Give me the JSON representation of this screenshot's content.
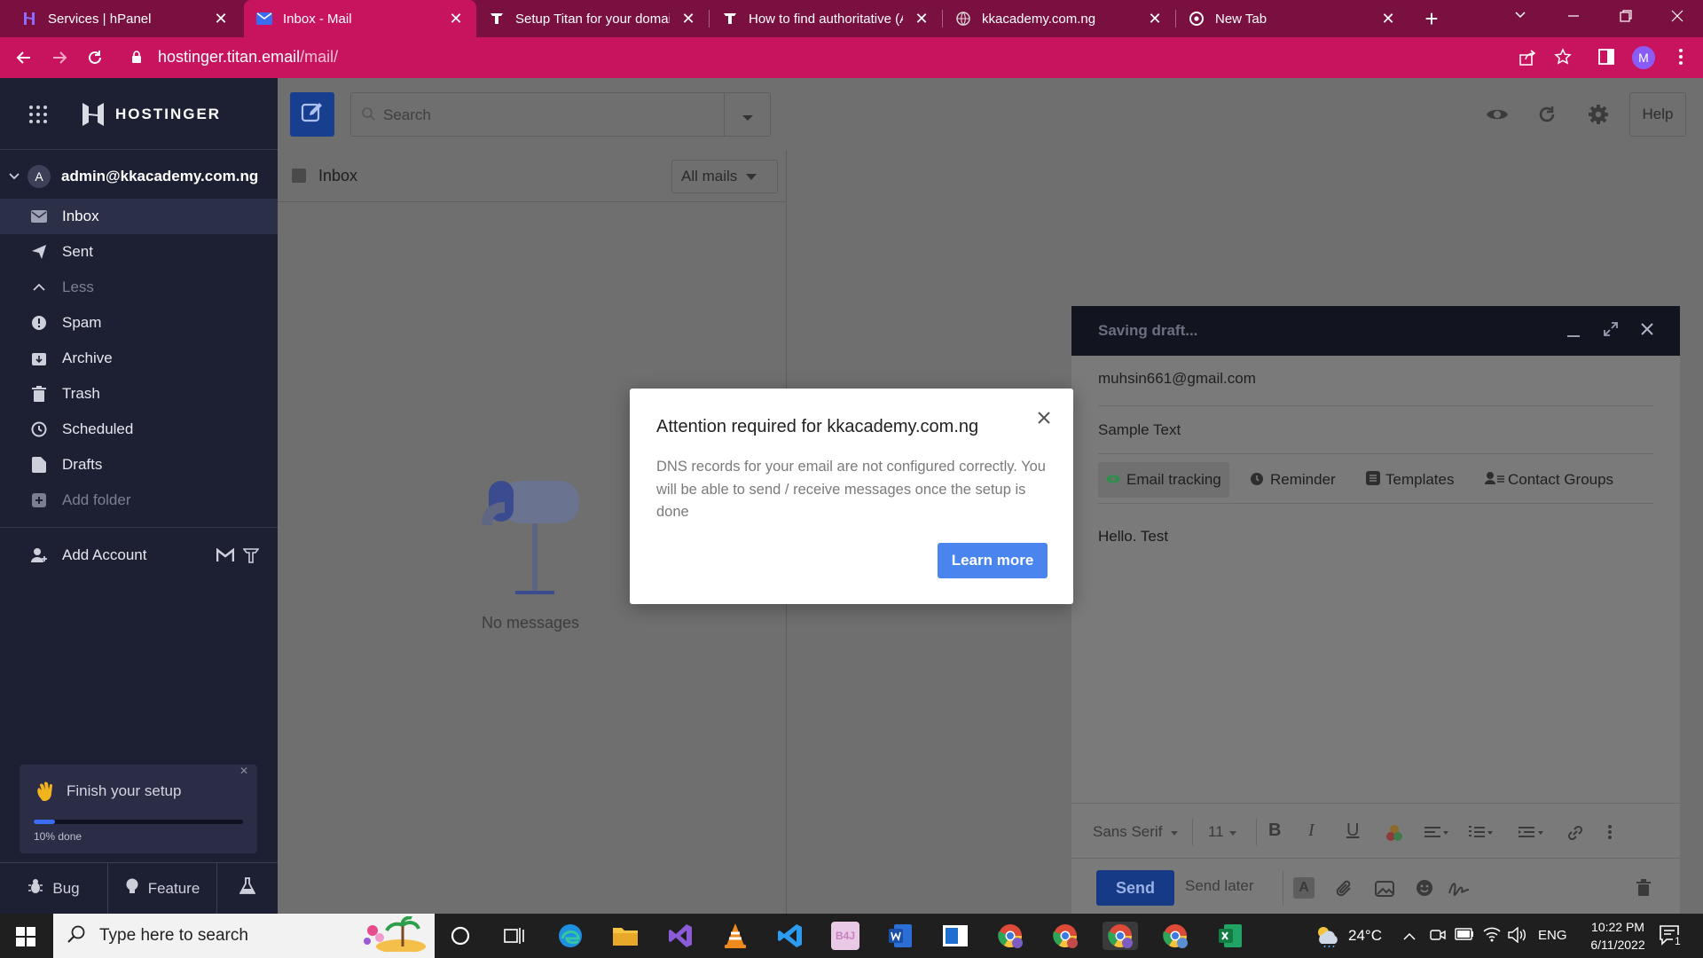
{
  "browser": {
    "tabs": [
      {
        "title": "Services | hPanel",
        "icon": "hostinger-icon"
      },
      {
        "title": "Inbox - Mail",
        "icon": "mail-icon"
      },
      {
        "title": "Setup Titan for your domair",
        "icon": "titan-icon"
      },
      {
        "title": "How to find authoritative (A",
        "icon": "titan-icon"
      },
      {
        "title": "kkacademy.com.ng",
        "icon": "globe-icon"
      },
      {
        "title": "New Tab",
        "icon": "chrome-icon"
      }
    ],
    "new_tab": "+",
    "url_host": "hostinger.titan.email",
    "url_path": "/mail/",
    "profile_initial": "M"
  },
  "app": {
    "brand": "HOSTINGER",
    "account": {
      "initial": "A",
      "email": "admin@kkacademy.com.ng"
    },
    "folders": [
      {
        "label": "Inbox",
        "icon": "inbox-icon"
      },
      {
        "label": "Sent",
        "icon": "send-icon"
      },
      {
        "label": "Less",
        "icon": "chevron-up-icon"
      },
      {
        "label": "Spam",
        "icon": "spam-icon"
      },
      {
        "label": "Archive",
        "icon": "archive-icon"
      },
      {
        "label": "Trash",
        "icon": "trash-icon"
      },
      {
        "label": "Scheduled",
        "icon": "scheduled-icon"
      },
      {
        "label": "Drafts",
        "icon": "drafts-icon"
      },
      {
        "label": "Add folder",
        "icon": "add-folder-icon"
      }
    ],
    "add_account": "Add Account",
    "setup": {
      "title": "Finish your setup",
      "progress_text": "10% done",
      "progress": 0.1
    },
    "bottom": {
      "bug": "Bug",
      "feature": "Feature"
    },
    "search_placeholder": "Search",
    "help": "Help",
    "list": {
      "title": "Inbox",
      "filter": "All mails",
      "empty": "No messages"
    }
  },
  "dialog": {
    "title": "Attention required for kkacademy.com.ng",
    "body": "DNS records for your email are not configured correctly. You will be able to send / receive messages once the setup is done",
    "button": "Learn more"
  },
  "composer": {
    "status": "Saving draft...",
    "to": "muhsin661@gmail.com",
    "subject": "Sample Text",
    "tools": [
      "Email tracking",
      "Reminder",
      "Templates",
      "Contact Groups"
    ],
    "body": "Hello. Test",
    "font": "Sans Serif",
    "size": "11",
    "send": "Send",
    "send_later": "Send later"
  },
  "taskbar": {
    "search": "Type here to search",
    "weather": "24°C",
    "lang": "ENG",
    "time": "10:22 PM",
    "date": "6/11/2022",
    "notif_count": "1"
  },
  "colors": {
    "accent": "#c8145f",
    "tabbar": "#7a1040",
    "sidebar": "#1d1f33",
    "primary": "#2a5ecf"
  }
}
